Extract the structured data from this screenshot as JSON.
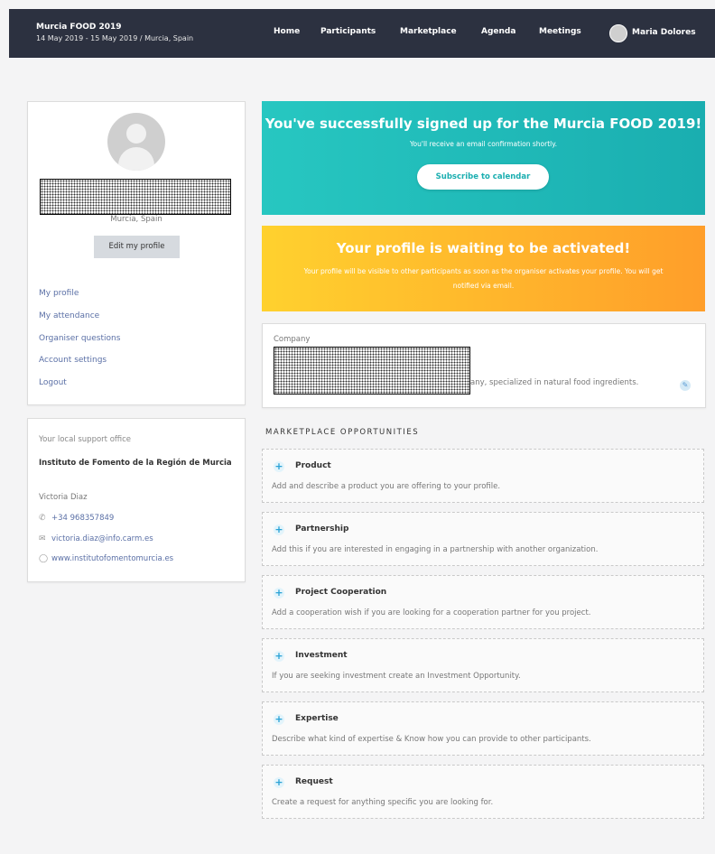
{
  "header": {
    "event_name": "Murcia FOOD 2019",
    "event_details": "14 May 2019 - 15 May 2019 / Murcia, Spain",
    "nav": [
      {
        "label": "Home"
      },
      {
        "label": "Participants"
      },
      {
        "label": "Marketplace"
      },
      {
        "label": "Agenda"
      },
      {
        "label": "Meetings"
      }
    ],
    "user_name": "Maria Dolores"
  },
  "profile": {
    "location": "Murcia, Spain",
    "edit_label": "Edit my profile",
    "menu": [
      {
        "label": "My profile"
      },
      {
        "label": "My attendance"
      },
      {
        "label": "Organiser questions"
      },
      {
        "label": "Account settings"
      },
      {
        "label": "Logout"
      }
    ]
  },
  "support": {
    "title": "Your local support office",
    "organisation": "Instituto de Fomento de la Región de Murcia",
    "person": "Victoria Diaz",
    "phone": "+34 968357849",
    "email": "victoria.diaz@info.carm.es",
    "website": "www.institutofomentomurcia.es"
  },
  "signup_banner": {
    "title": "You've successfully signed up for the Murcia FOOD 2019!",
    "subtitle": "You'll receive an email confirmation shortly.",
    "button": "Subscribe to calendar",
    "colors": [
      "#27c7c1",
      "#1aaeb0"
    ]
  },
  "activation_banner": {
    "title": "Your profile is waiting to be activated!",
    "subtitle": "Your profile will be visible to other participants as soon as the organiser activates your profile. You will get notified via email.",
    "colors": [
      "#ffd12e",
      "#ff9e2a"
    ]
  },
  "company": {
    "label": "Company",
    "description": "any, specialized in natural food ingredients."
  },
  "marketplace": {
    "heading": "MARKETPLACE OPPORTUNITIES",
    "items": [
      {
        "title": "Product",
        "desc": "Add and describe a product you are offering to your profile."
      },
      {
        "title": "Partnership",
        "desc": "Add this if you are interested in engaging in a partnership with another organization."
      },
      {
        "title": "Project Cooperation",
        "desc": "Add a cooperation wish if you are looking for a cooperation partner for you project."
      },
      {
        "title": "Investment",
        "desc": "If you are seeking investment create an Investment Opportunity."
      },
      {
        "title": "Expertise",
        "desc": "Describe what kind of expertise & Know how you can provide to other participants."
      },
      {
        "title": "Request",
        "desc": "Create a request for anything specific you are looking for."
      }
    ]
  }
}
